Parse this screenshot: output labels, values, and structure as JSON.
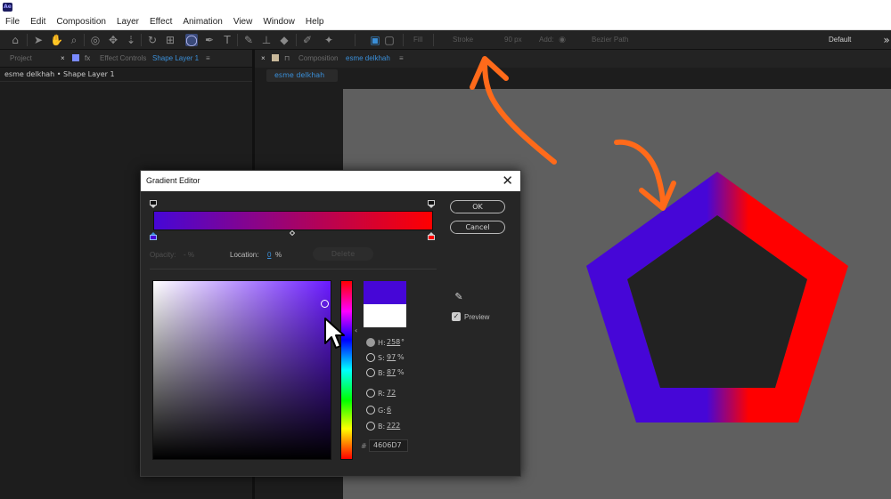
{
  "app": {
    "icon_text": "Ae"
  },
  "menu": [
    "File",
    "Edit",
    "Composition",
    "Layer",
    "Effect",
    "Animation",
    "View",
    "Window",
    "Help"
  ],
  "toolbar": {
    "fill_label": "Fill",
    "stroke_label": "Stroke",
    "stroke_width": "90 px",
    "add_label": "Add:",
    "bezier_label": "Bezier Path",
    "workspace": "Default",
    "stroke_color": "#7a1a7a"
  },
  "left_panel": {
    "tab_project": "Project",
    "tab_effect_controls_prefix": "Effect Controls",
    "tab_effect_controls_layer": "Shape Layer 1",
    "breadcrumb": "esme delkhah • Shape Layer 1"
  },
  "composition_panel": {
    "tab_prefix": "Composition",
    "tab_name": "esme delkhah",
    "subtab": "esme delkhah"
  },
  "gradient_editor": {
    "title": "Gradient Editor",
    "ok_label": "OK",
    "cancel_label": "Cancel",
    "opacity_label": "Opacity:",
    "opacity_value": "- %",
    "location_label": "Location:",
    "location_value": "0",
    "location_unit": "%",
    "delete_label": "Delete",
    "preview_label": "Preview",
    "start_color": "#4606D7",
    "end_color": "#ff0000",
    "fields": {
      "h_label": "H:",
      "h_value": "258",
      "h_unit": "°",
      "s_label": "S:",
      "s_value": "97",
      "s_unit": "%",
      "b_label": "B:",
      "b_value": "87",
      "b_unit": "%",
      "r_label": "R:",
      "r_value": "72",
      "g_label": "G:",
      "g_value": "6",
      "bl_label": "B:",
      "bl_value": "222",
      "hex_prefix": "#",
      "hex_value": "4606D7"
    }
  },
  "annotation": {
    "arrow_color": "#ff6a1a"
  }
}
